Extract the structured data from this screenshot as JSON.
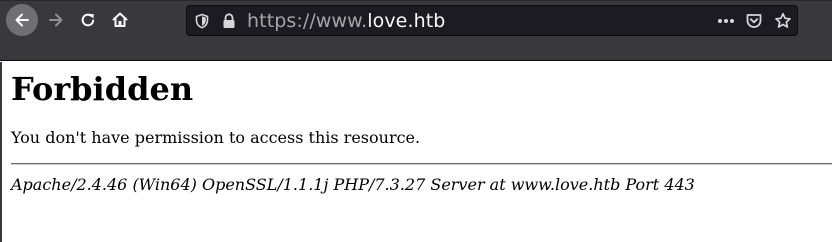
{
  "browser": {
    "url_prefix": "https://www.",
    "url_host": "love.htb",
    "icons": {
      "back": "back-arrow-icon",
      "forward": "forward-arrow-icon",
      "reload": "reload-icon",
      "home": "home-icon",
      "shield": "tracking-shield-icon",
      "lock": "lock-icon",
      "page_actions": "more-dots-icon",
      "pocket": "pocket-icon",
      "bookmark": "star-icon"
    },
    "colors": {
      "toolbar": "#38383d",
      "urlbar": "#1c1b22"
    }
  },
  "page": {
    "title": "Forbidden",
    "message": "You don't have permission to access this resource.",
    "server_signature": "Apache/2.4.46 (Win64) OpenSSL/1.1.1j PHP/7.3.27 Server at www.love.htb Port 443"
  }
}
